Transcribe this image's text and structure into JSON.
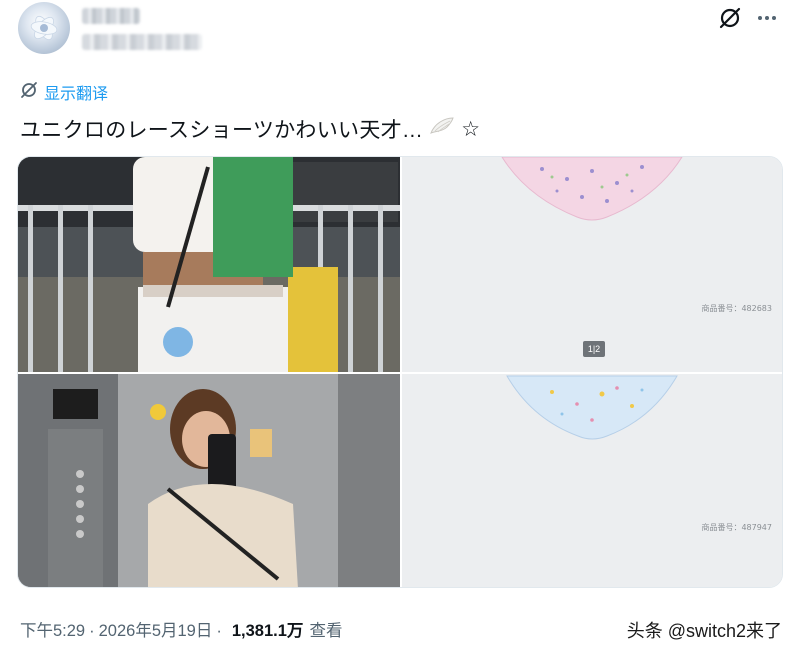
{
  "post": {
    "translate_label": "显示翻译",
    "text": "ユニクロのレースショーツかわいい天才…",
    "star": "☆",
    "timestamp": "下午5:29",
    "separator": "·",
    "date": "2026年5月19日",
    "views_count": "1,381.1万",
    "views_label": "查看"
  },
  "media": {
    "tile2_code": "商品番号：482683",
    "tile4_code": "商品番号：487947",
    "tile2_page": "1|2"
  },
  "header": {
    "icons": [
      "grok-icon",
      "more-icon"
    ]
  },
  "watermark": "头条 @switch2来了",
  "colors": {
    "link": "#1d9bf0",
    "text": "#0f1419",
    "muted": "#536471"
  }
}
